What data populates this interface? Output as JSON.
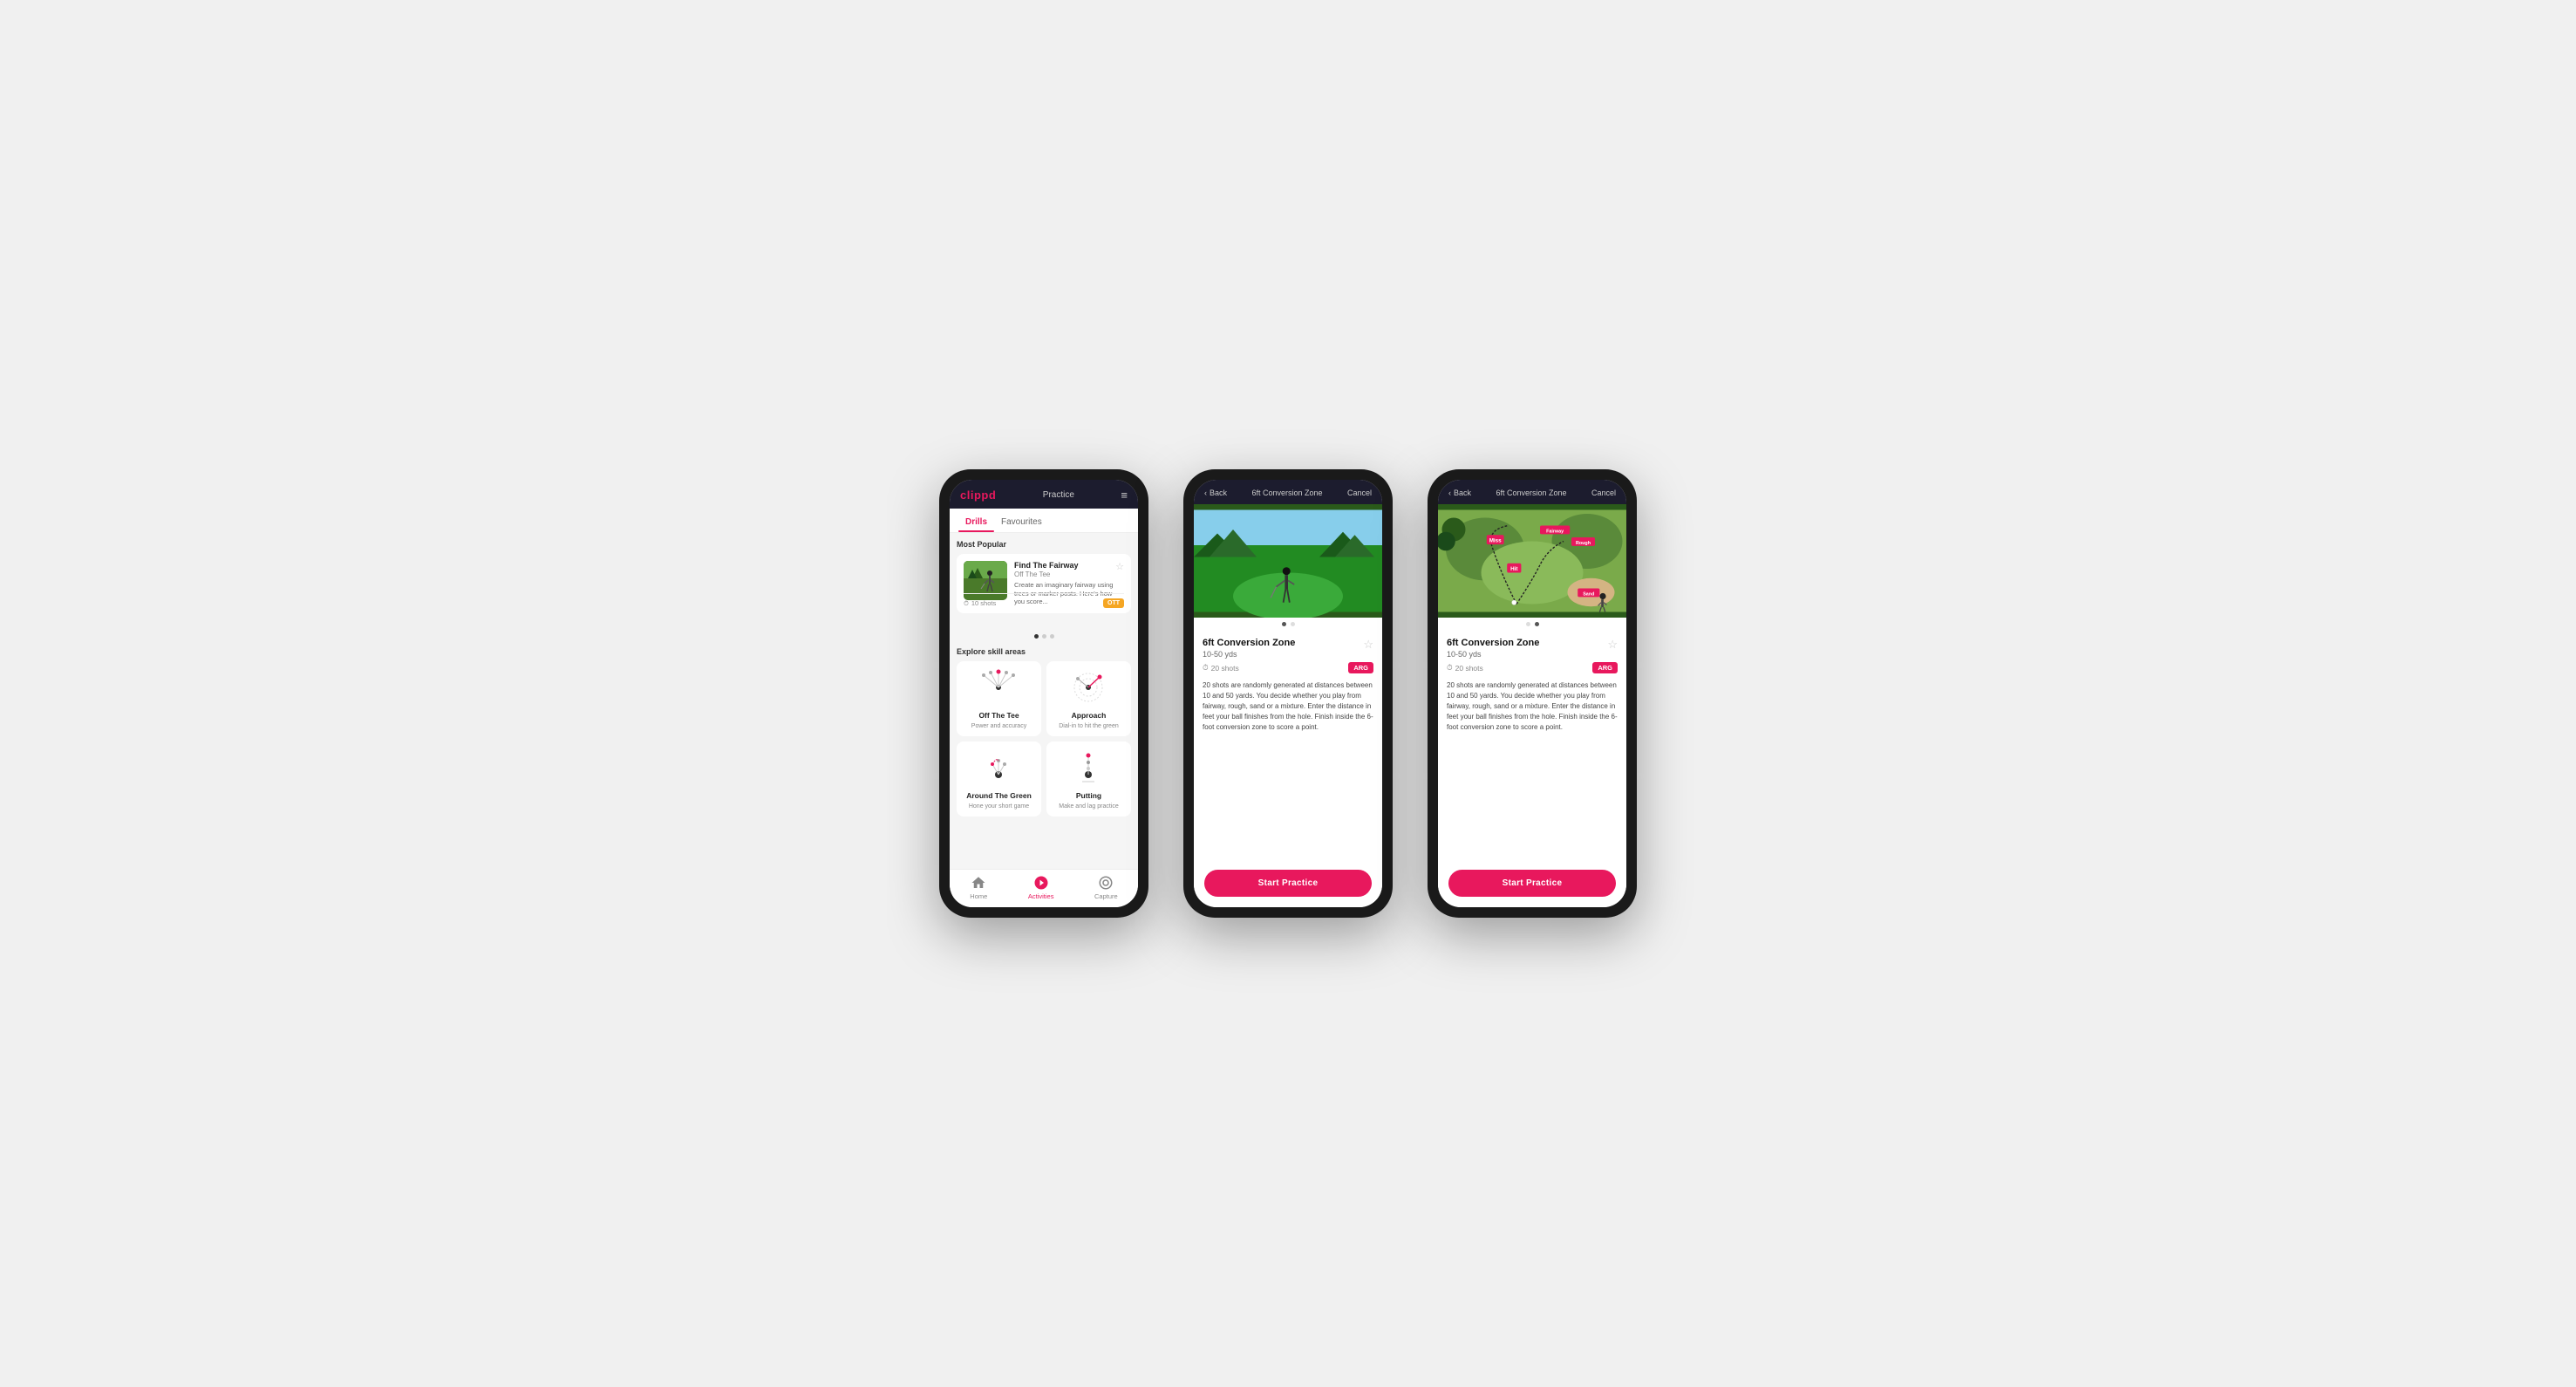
{
  "phones": {
    "phone1": {
      "header": {
        "logo": "clippd",
        "title": "Practice",
        "menu_icon": "≡"
      },
      "tabs": [
        {
          "label": "Drills",
          "active": true
        },
        {
          "label": "Favourites",
          "active": false
        }
      ],
      "most_popular_label": "Most Popular",
      "featured_drill": {
        "name": "Find The Fairway",
        "category": "Off The Tee",
        "description": "Create an imaginary fairway using trees or marker posts. Here's how you score...",
        "shots": "10 shots",
        "tag": "OTT"
      },
      "explore_label": "Explore skill areas",
      "skill_areas": [
        {
          "name": "Off The Tee",
          "desc": "Power and accuracy"
        },
        {
          "name": "Approach",
          "desc": "Dial-in to hit the green"
        },
        {
          "name": "Around The Green",
          "desc": "Hone your short game"
        },
        {
          "name": "Putting",
          "desc": "Make and lag practice"
        }
      ],
      "nav": [
        {
          "label": "Home",
          "icon": "home",
          "active": false
        },
        {
          "label": "Activities",
          "icon": "activities",
          "active": true
        },
        {
          "label": "Capture",
          "icon": "capture",
          "active": false
        }
      ]
    },
    "phone2": {
      "header": {
        "back": "Back",
        "title": "6ft Conversion Zone",
        "cancel": "Cancel"
      },
      "drill": {
        "name": "6ft Conversion Zone",
        "range": "10-50 yds",
        "shots": "20 shots",
        "tag": "ARG",
        "description": "20 shots are randomly generated at distances between 10 and 50 yards. You decide whether you play from fairway, rough, sand or a mixture. Enter the distance in feet your ball finishes from the hole. Finish inside the 6-foot conversion zone to score a point.",
        "start_label": "Start Practice"
      },
      "image_type": "photo"
    },
    "phone3": {
      "header": {
        "back": "Back",
        "title": "6ft Conversion Zone",
        "cancel": "Cancel"
      },
      "drill": {
        "name": "6ft Conversion Zone",
        "range": "10-50 yds",
        "shots": "20 shots",
        "tag": "ARG",
        "description": "20 shots are randomly generated at distances between 10 and 50 yards. You decide whether you play from fairway, rough, sand or a mixture. Enter the distance in feet your ball finishes from the hole. Finish inside the 6-foot conversion zone to score a point.",
        "start_label": "Start Practice"
      },
      "image_type": "map",
      "map_labels": [
        "Fairway",
        "Rough",
        "Miss",
        "Hit",
        "Sand"
      ]
    }
  },
  "colors": {
    "brand_red": "#e8185d",
    "dark_bg": "#1c1c2e",
    "tag_orange": "#f5a623"
  }
}
